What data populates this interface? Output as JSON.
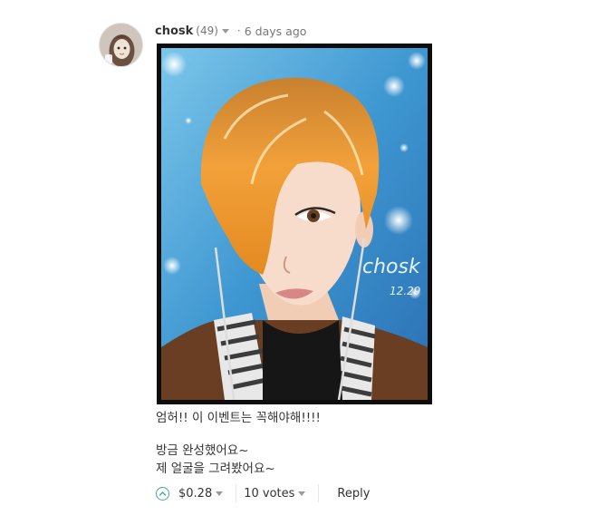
{
  "comment": {
    "author": "chosk",
    "reputation": "(49)",
    "separator": "·",
    "timestamp": "6 days ago",
    "body": [
      "엄허!! 이 이벤트는 꼭해야해!!!!",
      "방금 완성했어요~",
      "제 얼굴을 그려봤어요~"
    ],
    "artwork_signature": "chosk 12.29"
  },
  "footer": {
    "payout": "$0.28",
    "votes": "10 votes",
    "reply": "Reply"
  },
  "colors": {
    "upvote_accent": "#4aa2a6",
    "text": "#333333",
    "muted": "#777777"
  },
  "icons": {
    "upvote": "chevron-up-circle-icon",
    "dropdown": "caret-down-icon"
  }
}
